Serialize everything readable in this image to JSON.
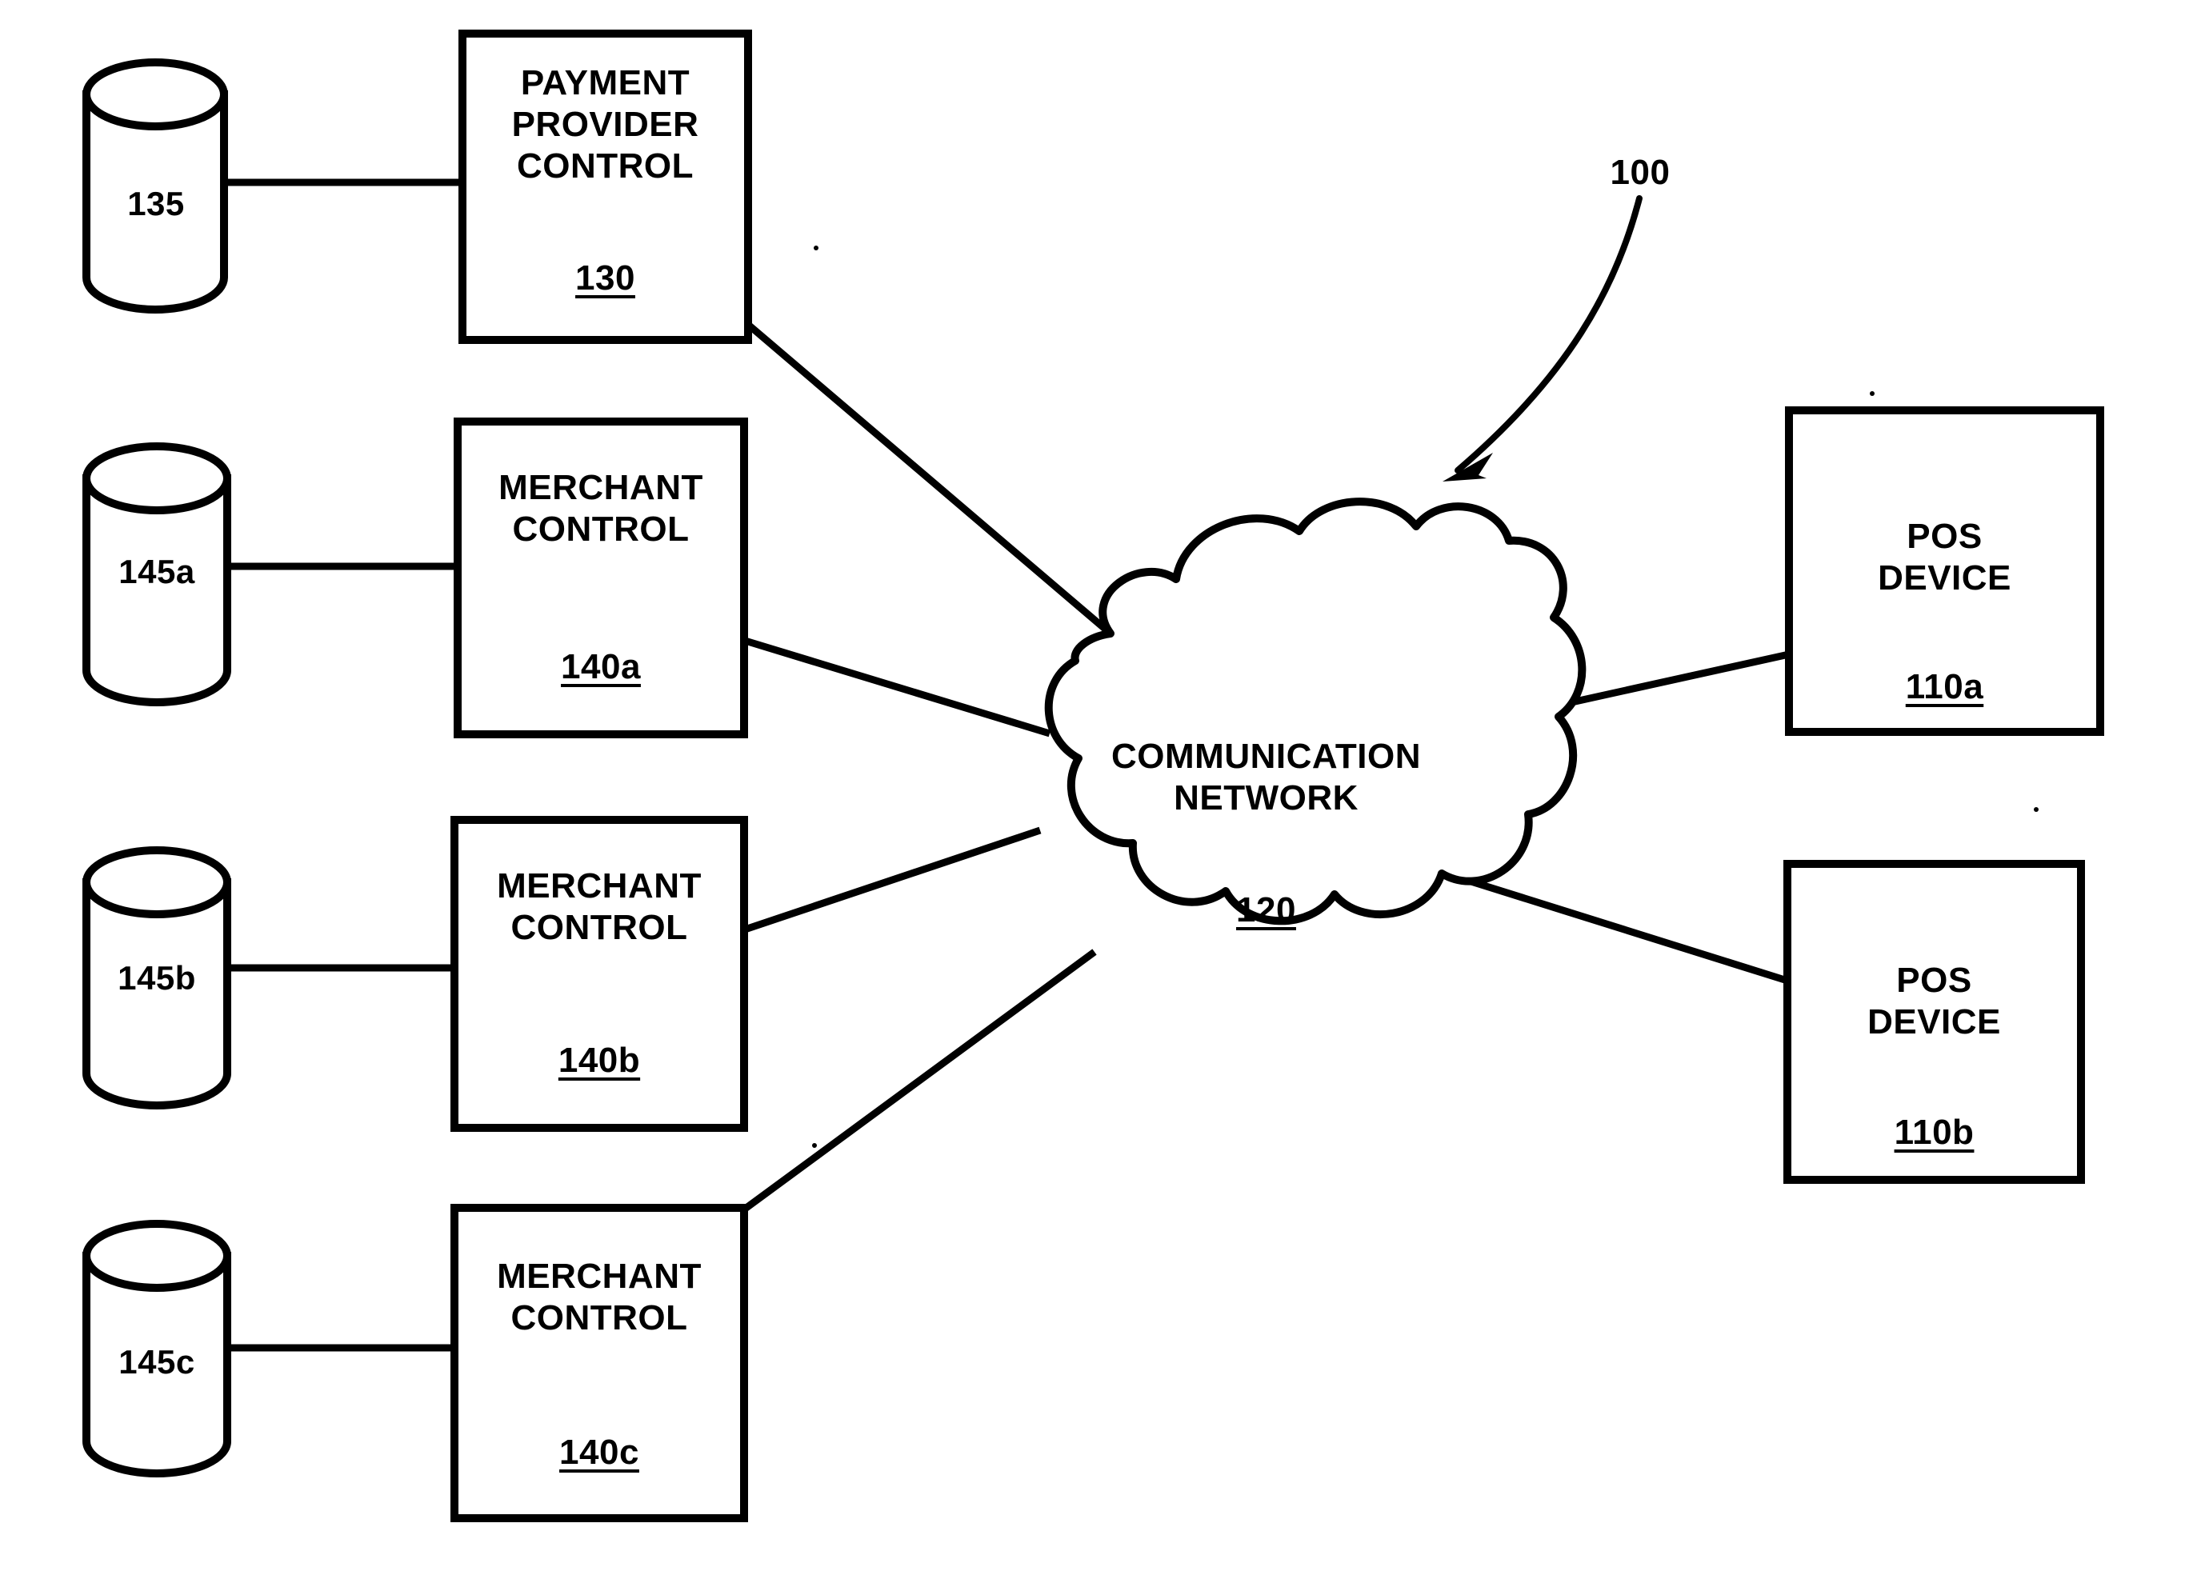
{
  "figure": {
    "system_ref": "100",
    "nodes": {
      "payment_provider_control": {
        "title": "PAYMENT\nPROVIDER\nCONTROL",
        "ref": "130"
      },
      "payment_provider_db": {
        "ref": "135"
      },
      "merchant_control_a": {
        "title": "MERCHANT\nCONTROL",
        "ref": "140a"
      },
      "merchant_db_a": {
        "ref": "145a"
      },
      "merchant_control_b": {
        "title": "MERCHANT\nCONTROL",
        "ref": "140b"
      },
      "merchant_db_b": {
        "ref": "145b"
      },
      "merchant_control_c": {
        "title": "MERCHANT\nCONTROL",
        "ref": "140c"
      },
      "merchant_db_c": {
        "ref": "145c"
      },
      "communication_network": {
        "title": "COMMUNICATION\nNETWORK",
        "ref": "120"
      },
      "pos_device_a": {
        "title": "POS\nDEVICE",
        "ref": "110a"
      },
      "pos_device_b": {
        "title": "POS\nDEVICE",
        "ref": "110b"
      }
    },
    "colors": {
      "ink": "#000000",
      "paper": "#ffffff"
    }
  }
}
